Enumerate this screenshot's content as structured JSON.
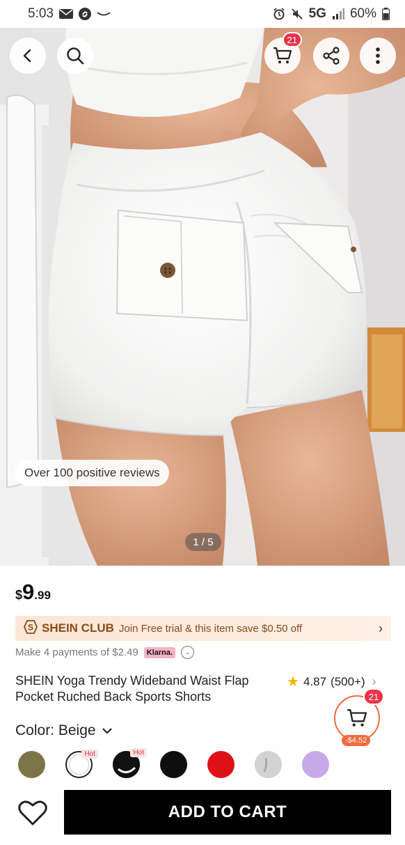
{
  "status_bar": {
    "time": "5:03",
    "network": "5G",
    "battery": "60%"
  },
  "header": {
    "cart_count": "21",
    "icons": [
      "back-arrow-icon",
      "search-icon",
      "cart-icon",
      "share-icon",
      "more-vertical-icon"
    ]
  },
  "gallery": {
    "reviews_badge": "Over 100 positive reviews",
    "page_indicator": "1 / 5"
  },
  "product": {
    "price_currency": "$",
    "price_main": "9",
    "price_cents": ".99",
    "title": "SHEIN Yoga Trendy Wideband Waist Flap Pocket Ruched Back Sports Shorts",
    "rating": "4.87",
    "review_count": "(500+)"
  },
  "club": {
    "brand": "SHEIN CLUB",
    "text": "Join Free trial & this item save $0.50 off"
  },
  "klarna": {
    "text": "Make 4 payments of $2.49",
    "badge": "Klarna."
  },
  "floating_cart": {
    "count": "21",
    "discount": "-$4.52"
  },
  "color": {
    "label": "Color: Beige"
  },
  "swatches": [
    {
      "name": "olive",
      "color": "#7d7547",
      "hot": ""
    },
    {
      "name": "white",
      "color": "#ffffff",
      "hot": "Hot"
    },
    {
      "name": "black-white",
      "color": "#111111",
      "hot": "Hot"
    },
    {
      "name": "black",
      "color": "#0e0e0e",
      "hot": ""
    },
    {
      "name": "red",
      "color": "#e01018",
      "hot": ""
    },
    {
      "name": "grey",
      "color": "#c8c8c8",
      "hot": ""
    },
    {
      "name": "lilac",
      "color": "#c8a9e8",
      "hot": ""
    }
  ],
  "bottom": {
    "add_to_cart": "ADD TO CART"
  }
}
